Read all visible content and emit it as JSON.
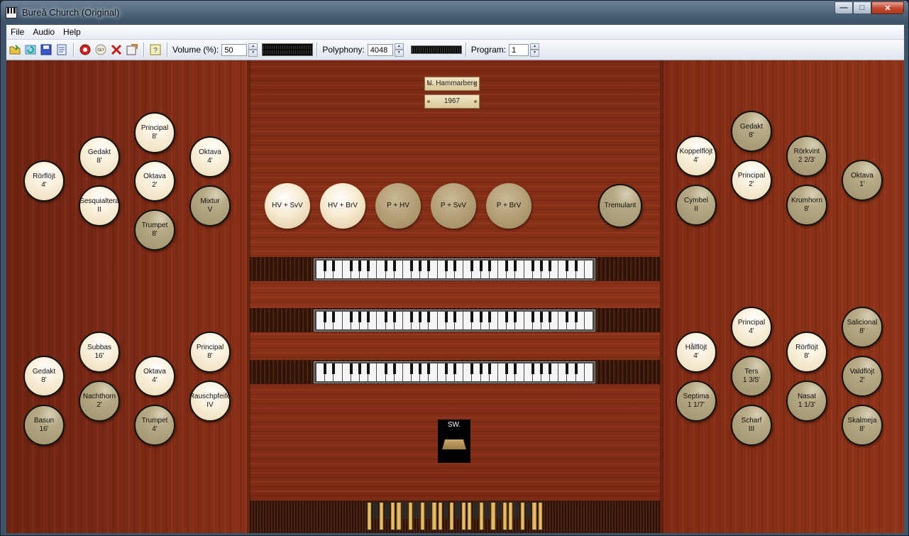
{
  "window": {
    "title": "Bureå Church (Original)"
  },
  "menu": [
    "File",
    "Audio",
    "Help"
  ],
  "toolbar": {
    "volume_label": "Volume (%):",
    "volume_value": "50",
    "polyphony_label": "Polyphony:",
    "polyphony_value": "4048",
    "program_label": "Program:",
    "program_value": "1"
  },
  "plates": {
    "builder": "N. Hammarberg",
    "year": "1967"
  },
  "left_upper_stops": [
    {
      "name": "Principal",
      "pitch": "8'",
      "on": true
    },
    {
      "name": "Gedakt",
      "pitch": "8'",
      "on": true
    },
    {
      "name": "Oktava",
      "pitch": "4'",
      "on": true
    },
    {
      "name": "Rörflöjt",
      "pitch": "4'",
      "on": true
    },
    {
      "name": "Oktava",
      "pitch": "2'",
      "on": true
    },
    {
      "name": "Sesquialtera",
      "pitch": "II",
      "on": true
    },
    {
      "name": "Mixtur",
      "pitch": "V",
      "on": false
    },
    {
      "name": "Trumpet",
      "pitch": "8'",
      "on": false
    }
  ],
  "left_lower_stops": [
    {
      "name": "Subbas",
      "pitch": "16'",
      "on": true
    },
    {
      "name": "Principal",
      "pitch": "8'",
      "on": true
    },
    {
      "name": "Gedakt",
      "pitch": "8'",
      "on": true
    },
    {
      "name": "Oktava",
      "pitch": "4'",
      "on": true
    },
    {
      "name": "Nachthorn",
      "pitch": "2'",
      "on": false
    },
    {
      "name": "Rauschpfeife",
      "pitch": "IV",
      "on": true
    },
    {
      "name": "Basun",
      "pitch": "16'",
      "on": false
    },
    {
      "name": "Trumpet",
      "pitch": "4'",
      "on": false
    }
  ],
  "couplers": [
    {
      "name": "HV + SvV",
      "on": true
    },
    {
      "name": "HV + BrV",
      "on": true
    },
    {
      "name": "P + HV",
      "on": false
    },
    {
      "name": "P + SvV",
      "on": false
    },
    {
      "name": "P + BrV",
      "on": false
    }
  ],
  "tremulant": {
    "name": "Tremulant",
    "on": false
  },
  "right_upper_stops": [
    {
      "name": "Gedakt",
      "pitch": "8'",
      "on": false
    },
    {
      "name": "Koppelflöjt",
      "pitch": "4'",
      "on": true
    },
    {
      "name": "Rörkvint",
      "pitch": "2 2/3'",
      "on": false
    },
    {
      "name": "Principal",
      "pitch": "2'",
      "on": true
    },
    {
      "name": "Oktava",
      "pitch": "1'",
      "on": false
    },
    {
      "name": "Cymbel",
      "pitch": "II",
      "on": false
    },
    {
      "name": "Krumhorn",
      "pitch": "8'",
      "on": false
    }
  ],
  "right_lower_stops": [
    {
      "name": "Principal",
      "pitch": "4'",
      "on": true
    },
    {
      "name": "Salicional",
      "pitch": "8'",
      "on": false
    },
    {
      "name": "Hålflöjt",
      "pitch": "4'",
      "on": true
    },
    {
      "name": "Rörflöjt",
      "pitch": "8'",
      "on": true
    },
    {
      "name": "Ters",
      "pitch": "1 3/5'",
      "on": false
    },
    {
      "name": "Valdflöjt",
      "pitch": "2'",
      "on": false
    },
    {
      "name": "Septima",
      "pitch": "1 1/7'",
      "on": false
    },
    {
      "name": "Nasat",
      "pitch": "1 1/3'",
      "on": false
    },
    {
      "name": "Scharf",
      "pitch": "III",
      "on": false
    },
    {
      "name": "Skalmeja",
      "pitch": "8'",
      "on": false
    }
  ],
  "swell": {
    "label": "SW."
  }
}
